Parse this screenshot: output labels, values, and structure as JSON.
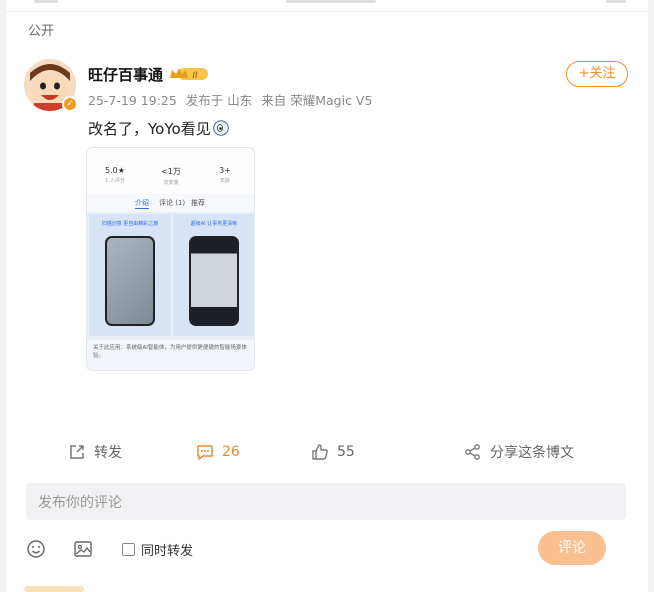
{
  "visibility": "公开",
  "author": {
    "name": "旺仔百事通",
    "vip_level": "II"
  },
  "meta": {
    "timestamp": "25-7-19 19:25",
    "posted_in_label": "发布于 山东",
    "source": "来自 荣耀Magic V5"
  },
  "follow_label": "+关注",
  "post": {
    "text": "改名了，YoYo看见"
  },
  "image": {
    "stats": [
      {
        "value": "5.0★",
        "label": "1 人评分"
      },
      {
        "value": "<1万",
        "label": "次安装"
      },
      {
        "value": "3+",
        "label": "年龄"
      }
    ],
    "tabs": [
      "介绍",
      "评论 (1)",
      "推荐"
    ],
    "panel_captions": [
      "扫描创意 更自由精彩之旅",
      "超级AI 让事务更清晰"
    ],
    "footer_text": "关于此应用：系统级AI智能体，为用户提供更便捷的智能场景体验。"
  },
  "actions": {
    "repost_label": "转发",
    "comment_count": "26",
    "like_count": "55",
    "share_label": "分享这条博文"
  },
  "comment_input": {
    "placeholder": "发布你的评论"
  },
  "toolbar": {
    "repost_check_label": "同时转发",
    "submit_label": "评论"
  },
  "colors": {
    "accent": "#f08c2a",
    "submit_disabled": "#fbc08f"
  }
}
